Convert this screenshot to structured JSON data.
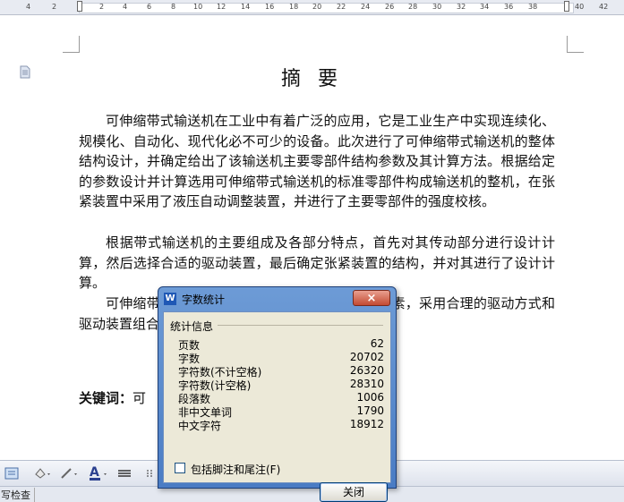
{
  "ruler": {
    "ticks": [
      "4",
      "2",
      "2",
      "4",
      "6",
      "8",
      "10",
      "12",
      "14",
      "16",
      "18",
      "20",
      "22",
      "24",
      "26",
      "28",
      "30",
      "32",
      "34",
      "36",
      "38",
      "40",
      "42"
    ]
  },
  "document": {
    "title": "摘 要",
    "paragraphs": [
      "可伸缩带式输送机在工业中有着广泛的应用，它是工业生产中实现连续化、规模化、自动化、现代化必不可少的设备。此次进行了可伸缩带式输送机的整体结构设计，并确定给出了该输送机主要零部件结构参数及其计算方法。根据给定的参数设计并计算选用可伸缩带式输送机的标准零部件构成输送机的整机，在张紧装置中采用了液压自动调整装置，并进行了主要零部件的强度校核。",
      "根据带式输送机的主要组成及各部分特点，首先对其传动部分进行设计计算，然后选择合适的驱动装置，最后确定张紧装置的结构，并对其进行了设计计算。",
      "可伸缩带式输送机在设计中综合考虑各方面的因素，采用合理的驱动方式和驱动装置组合，有效保证带式输送机的可靠运行。"
    ],
    "keywords_label": "关键词：",
    "keywords_visible": "可"
  },
  "statusbar": {
    "item": "写检查"
  },
  "dialog": {
    "title": "字数统计",
    "close_label": "×",
    "group_label": "统计信息",
    "stats": [
      {
        "label": "页数",
        "value": "62"
      },
      {
        "label": "字数",
        "value": "20702"
      },
      {
        "label": "字符数(不计空格)",
        "value": "26320"
      },
      {
        "label": "字符数(计空格)",
        "value": "28310"
      },
      {
        "label": "段落数",
        "value": "1006"
      },
      {
        "label": "非中文单词",
        "value": "1790"
      },
      {
        "label": "中文字符",
        "value": "18912"
      }
    ],
    "checkbox_label": "包括脚注和尾注(F)",
    "ok_label": "关闭"
  }
}
